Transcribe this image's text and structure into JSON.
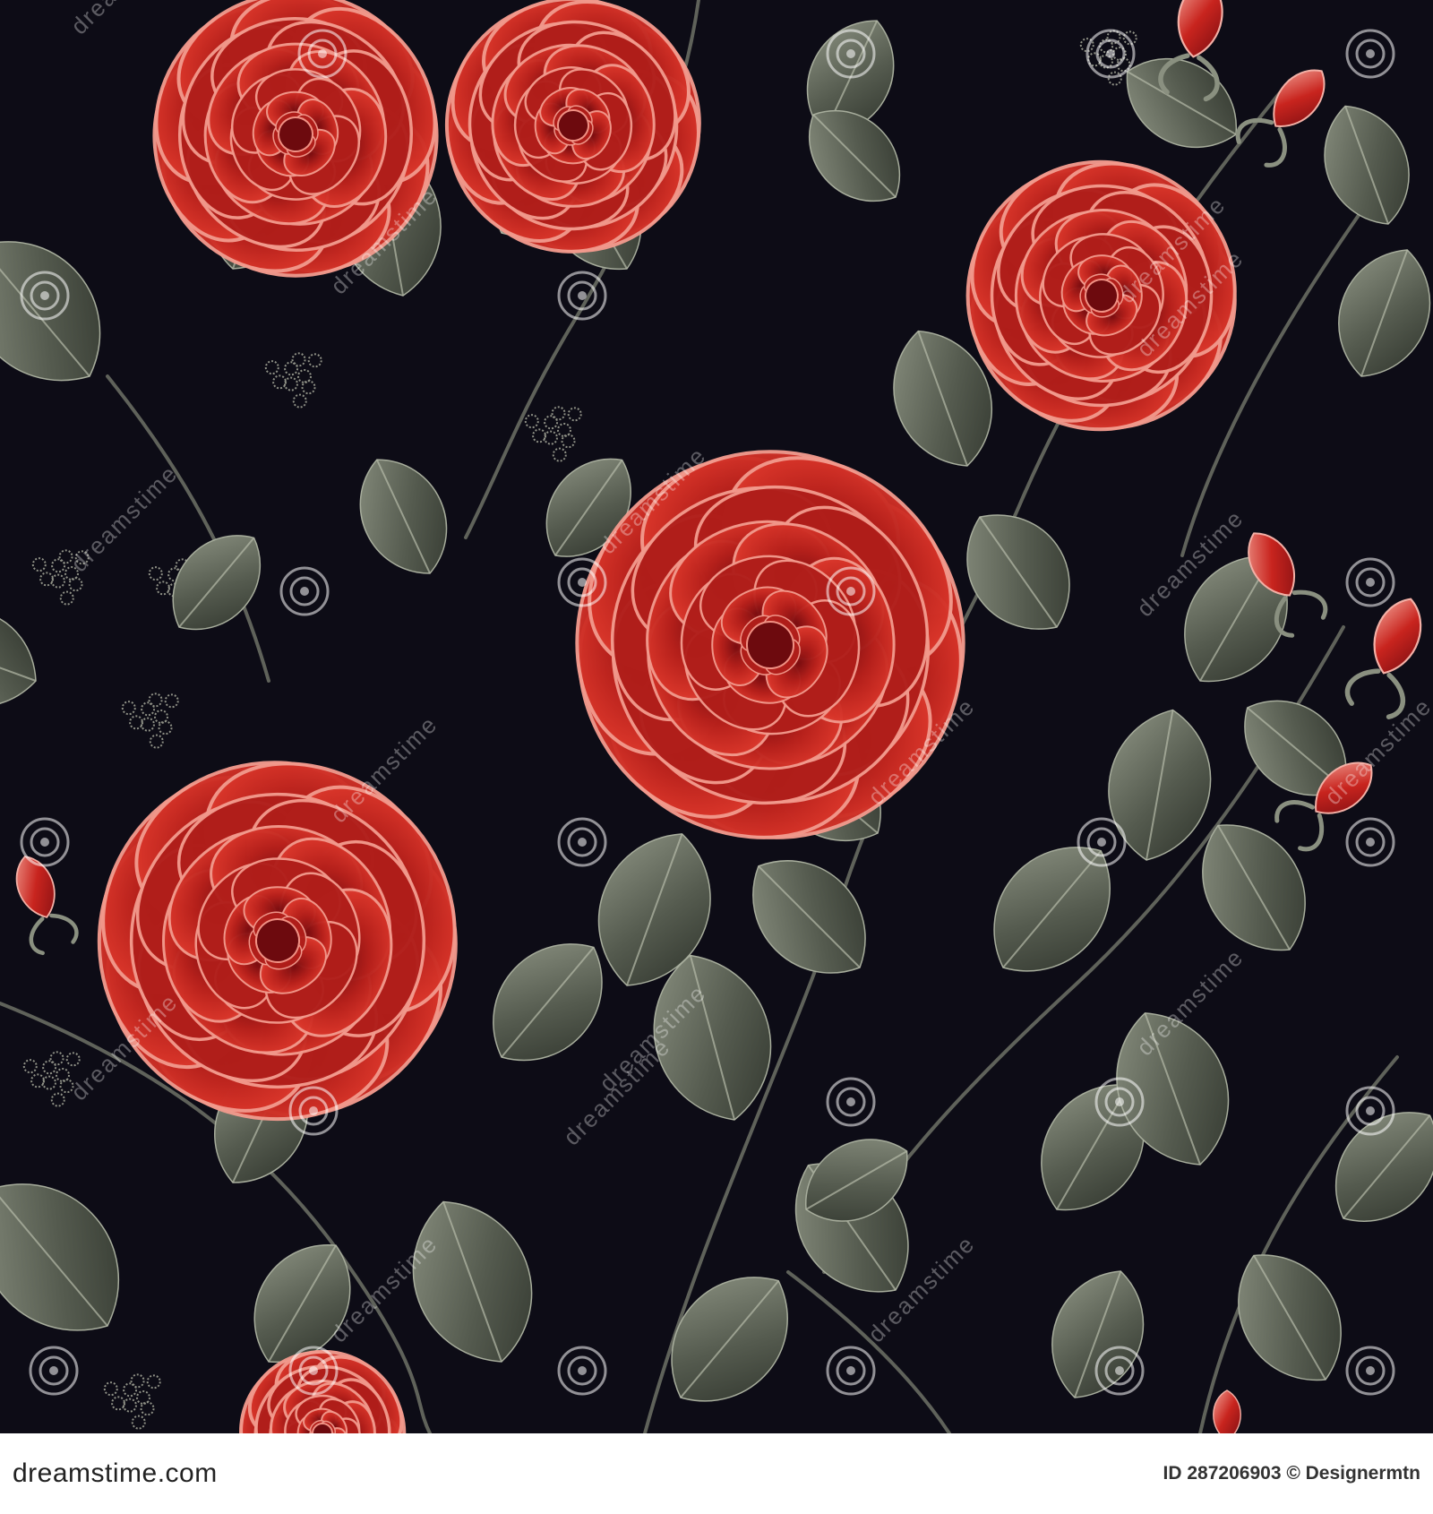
{
  "watermark": {
    "site": "dreamstime",
    "icon": "swirl-icon"
  },
  "footer": {
    "brand": "dreamstime.com",
    "credit": "ID 287206903 © Designermtn"
  },
  "colors": {
    "background": "#0d0c16",
    "rose": "#c9281f",
    "rose_highlight": "#f08c80",
    "rose_shadow": "#7a0d10",
    "leaf": "#4d5348",
    "leaf_light": "#9aa08f",
    "footer_bar": "#ffffff",
    "footer_text": "#222222",
    "footer_credit": "#333333"
  }
}
